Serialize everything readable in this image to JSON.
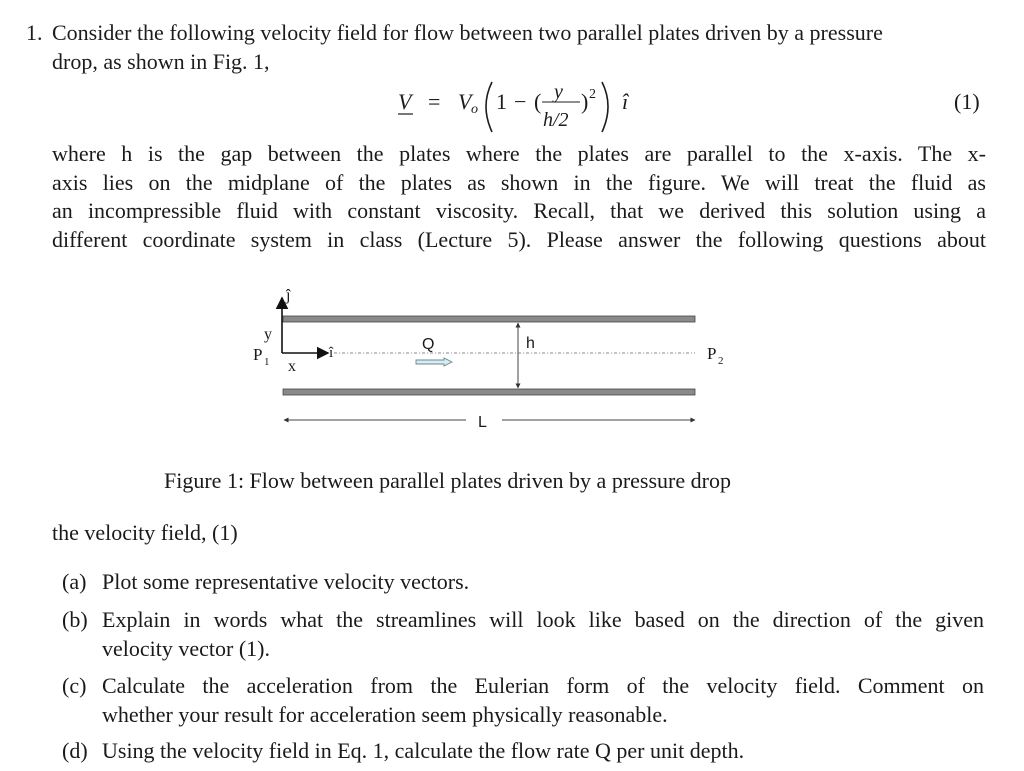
{
  "problem": {
    "number": "1.",
    "intro_line1": "Consider the following velocity field for flow between two parallel plates driven by a pressure",
    "intro_line2": "drop, as shown in Fig. 1,",
    "equation": {
      "lhs": "V",
      "equals": "=",
      "coef": "V",
      "coef_sub": "o",
      "one": "1",
      "minus": "−",
      "numerator": "y",
      "denominator": "h/2",
      "exponent": "2",
      "unit_vector": "î",
      "label": "(1)"
    },
    "para2_lines": [
      "where h is the gap between the plates where the plates are parallel to the x-axis. The x-",
      "axis lies on the midplane of the plates as shown in the figure. We will treat the fluid as",
      "an incompressible fluid with constant viscosity. Recall, that we derived this solution using a",
      "different coordinate system in class (Lecture 5). Please answer the following questions about"
    ]
  },
  "figure": {
    "labels": {
      "j_hat": "ĵ",
      "i_hat": "î",
      "y": "y",
      "x": "x",
      "p1": "P",
      "p1_sub": "1",
      "p2": "P",
      "p2_sub": "2",
      "q": "Q",
      "h": "h",
      "l": "L"
    },
    "colors": {
      "plate": "#8a8a8a",
      "plate_border": "#444444",
      "q_arrow_fill": "#d8ecf2",
      "q_arrow_stroke": "#6a8a95"
    },
    "caption": "Figure 1: Flow between parallel plates driven by a pressure drop"
  },
  "lead_in": "the velocity field, (1)",
  "questions": [
    {
      "label": "(a)",
      "lines": [
        "Plot some representative velocity vectors."
      ]
    },
    {
      "label": "(b)",
      "lines": [
        "Explain in words what the streamlines will look like based on the direction of the given",
        "velocity vector (1)."
      ]
    },
    {
      "label": "(c)",
      "lines": [
        "Calculate the acceleration from the Eulerian form of the velocity field. Comment on",
        "whether your result for acceleration seem physically reasonable."
      ]
    },
    {
      "label": "(d)",
      "lines": [
        "Using the velocity field in Eq. 1, calculate the flow rate Q per unit depth."
      ]
    }
  ]
}
